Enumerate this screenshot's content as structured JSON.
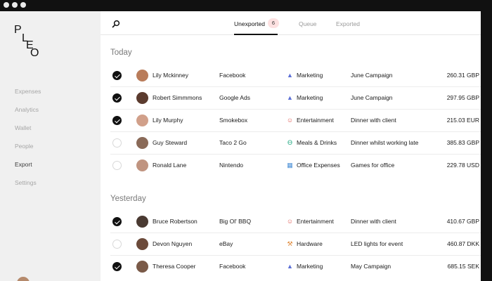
{
  "sidebar": {
    "logo_letters": [
      "P",
      "L",
      "E",
      "O"
    ],
    "nav": [
      {
        "label": "Expenses"
      },
      {
        "label": "Analytics"
      },
      {
        "label": "Wallet"
      },
      {
        "label": "People"
      },
      {
        "label": "Export"
      },
      {
        "label": "Settings"
      }
    ],
    "active_item": "Export"
  },
  "header": {
    "search_icon": "search-icon",
    "tabs": [
      {
        "label": "Unexported",
        "count": "6"
      },
      {
        "label": "Queue"
      },
      {
        "label": "Exported"
      }
    ]
  },
  "sections": [
    {
      "title": "Today",
      "rows": [
        {
          "checked": true,
          "name": "Lily Mckinney",
          "merchant": "Facebook",
          "category": "Marketing",
          "cat_icon": "megaphone-icon",
          "note": "June Campaign",
          "amount": "260.31 GBP",
          "avatar_color": "#b97c5a"
        },
        {
          "checked": true,
          "name": "Robert Simmmons",
          "merchant": "Google Ads",
          "category": "Marketing",
          "cat_icon": "megaphone-icon",
          "note": "June Campaign",
          "amount": "297.95 GBP",
          "avatar_color": "#5b3b2e"
        },
        {
          "checked": true,
          "name": "Lily Murphy",
          "merchant": "Smokebox",
          "category": "Entertainment",
          "cat_icon": "smiley-icon",
          "note": "Dinner with client",
          "amount": "215.03 EUR",
          "avatar_color": "#d1a08a"
        },
        {
          "checked": false,
          "name": "Guy Steward",
          "merchant": "Taco 2 Go",
          "category": "Meals & Drinks",
          "cat_icon": "utensils-icon",
          "note": "Dinner whilst working late",
          "amount": "385.83 GBP",
          "avatar_color": "#8a6a58"
        },
        {
          "checked": false,
          "name": "Ronald Lane",
          "merchant": "Nintendo",
          "category": "Office Expenses",
          "cat_icon": "building-icon",
          "note": "Games for office",
          "amount": "229.78 USD",
          "avatar_color": "#c09480"
        }
      ]
    },
    {
      "title": "Yesterday",
      "rows": [
        {
          "checked": true,
          "name": "Bruce Robertson",
          "merchant": "Big Ol' BBQ",
          "category": "Entertainment",
          "cat_icon": "smiley-icon",
          "note": "Dinner with client",
          "amount": "410.67 GBP",
          "avatar_color": "#4a3a32"
        },
        {
          "checked": false,
          "name": "Devon Nguyen",
          "merchant": "eBay",
          "category": "Hardware",
          "cat_icon": "wrench-icon",
          "note": "LED lights for event",
          "amount": "460.87 DKK",
          "avatar_color": "#6b4a3a"
        },
        {
          "checked": true,
          "name": "Theresa Cooper",
          "merchant": "Facebook",
          "category": "Marketing",
          "cat_icon": "megaphone-icon",
          "note": "May Campaign",
          "amount": "685.15 SEK",
          "avatar_color": "#7a5a48"
        }
      ]
    }
  ],
  "colors": {
    "marketing": "#5b6fd6",
    "entertainment": "#e0605a",
    "meals": "#2fae8a",
    "office": "#4a8fd6",
    "hardware": "#e08a3a",
    "count_badge": "#fde1e1"
  }
}
